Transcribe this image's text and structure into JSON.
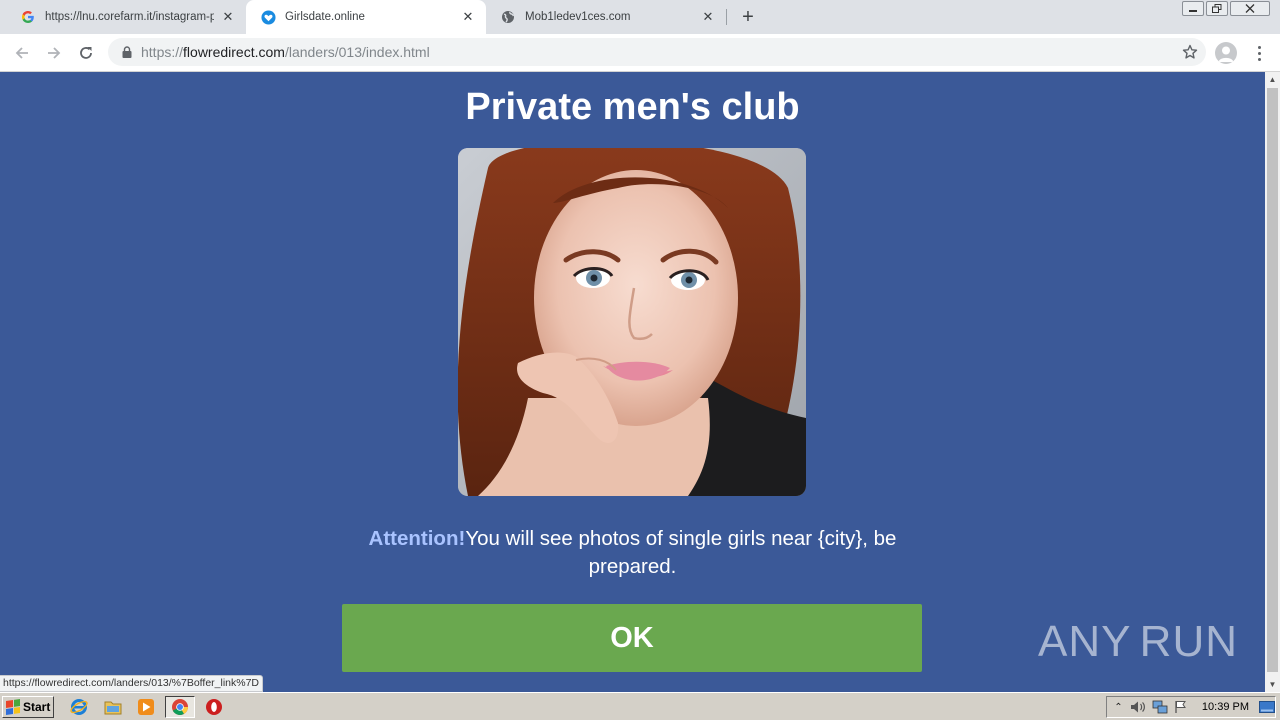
{
  "browser": {
    "tabs": [
      {
        "title": "https://lnu.corefarm.it/instagram-pas",
        "favicon": "google-icon",
        "active": false
      },
      {
        "title": "Girlsdate.online",
        "favicon": "heart-badge-icon",
        "active": true
      },
      {
        "title": "Mob1ledev1ces.com",
        "favicon": "globe-icon",
        "active": false
      }
    ],
    "address": {
      "scheme": "https://",
      "host": "flowredirect.com",
      "path": "/landers/013/index.html"
    }
  },
  "page": {
    "headline": "Private men's club",
    "photo": "portrait-photo",
    "message": {
      "attention": "Attention!",
      "text": "You will see photos of single girls near {city}, be prepared."
    },
    "ok_label": "OK",
    "watermark": {
      "left": "ANY",
      "right": "RUN"
    },
    "status_url": "https://flowredirect.com/landers/013/%7Boffer_link%7D"
  },
  "colors": {
    "page_bg": "#3b5998",
    "ok_button": "#6aa84f",
    "attention": "#a9c3ff"
  },
  "taskbar": {
    "start_label": "Start",
    "clock": "10:39 PM"
  }
}
